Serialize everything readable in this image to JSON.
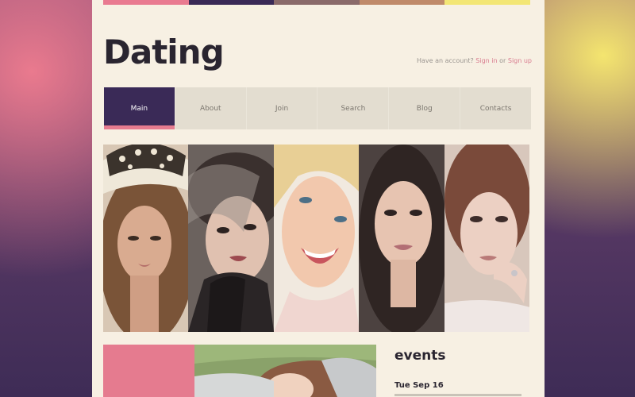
{
  "topbar": {
    "colors": [
      "#e97a90",
      "#3a2a57",
      "#8a6a6a",
      "#c08a6a",
      "#f3e675"
    ]
  },
  "header": {
    "logo_text": "Dating",
    "account_prompt": "Have an account?",
    "sign_in": "Sign in",
    "or": "or",
    "sign_up": "Sign up"
  },
  "nav": {
    "items": [
      {
        "label": "Main",
        "active": true
      },
      {
        "label": "About"
      },
      {
        "label": "Join"
      },
      {
        "label": "Search"
      },
      {
        "label": "Blog"
      },
      {
        "label": "Contacts"
      }
    ]
  },
  "gallery": {
    "photos": [
      "woman-with-hat-photo",
      "woman-with-veil-photo",
      "smiling-blonde-photo",
      "dark-haired-woman-photo",
      "auburn-haired-woman-photo"
    ]
  },
  "events": {
    "title": "events",
    "first_date": "Tue Sep 16"
  },
  "colors": {
    "accent_pink": "#e57b8f",
    "nav_active": "#3a2a57",
    "page_bg": "#f7f0e3"
  }
}
